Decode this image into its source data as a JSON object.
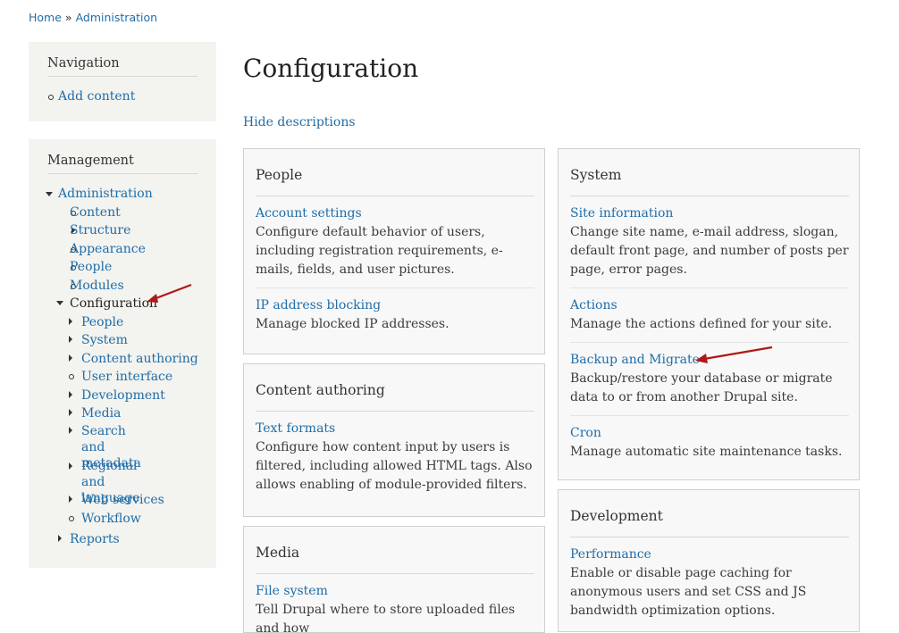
{
  "breadcrumb": {
    "home": "Home",
    "separator": "»",
    "admin": "Administration"
  },
  "navigation_block": {
    "title": "Navigation",
    "items": [
      "Add content"
    ]
  },
  "management_block": {
    "title": "Management",
    "administration": "Administration",
    "items": [
      "Content",
      "Structure",
      "Appearance",
      "People",
      "Modules",
      "Configuration"
    ],
    "config_children": [
      "People",
      "System",
      "Content authoring",
      "User interface",
      "Development",
      "Media",
      "Search and metadata",
      "Regional and language",
      "Web services",
      "Workflow"
    ],
    "reports": "Reports"
  },
  "main": {
    "title": "Configuration",
    "hide_descriptions": "Hide descriptions",
    "panels": {
      "people": {
        "title": "People",
        "items": [
          {
            "title": "Account settings",
            "desc": "Configure default behavior of users, including registration requirements, e-mails, fields, and user pictures."
          },
          {
            "title": "IP address blocking",
            "desc": "Manage blocked IP addresses."
          }
        ]
      },
      "content_authoring": {
        "title": "Content authoring",
        "items": [
          {
            "title": "Text formats",
            "desc": "Configure how content input by users is filtered, including allowed HTML tags. Also allows enabling of module-provided filters."
          }
        ]
      },
      "media": {
        "title": "Media",
        "items": [
          {
            "title": "File system",
            "desc": "Tell Drupal where to store uploaded files and how"
          }
        ]
      },
      "system": {
        "title": "System",
        "items": [
          {
            "title": "Site information",
            "desc": "Change site name, e-mail address, slogan, default front page, and number of posts per page, error pages."
          },
          {
            "title": "Actions",
            "desc": "Manage the actions defined for your site."
          },
          {
            "title": "Backup and Migrate",
            "desc": "Backup/restore your database or migrate data to or from another Drupal site."
          },
          {
            "title": "Cron",
            "desc": "Manage automatic site maintenance tasks."
          }
        ]
      },
      "development": {
        "title": "Development",
        "items": [
          {
            "title": "Performance",
            "desc": "Enable or disable page caching for anonymous users and set CSS and JS bandwidth optimization options."
          }
        ]
      }
    }
  },
  "colors": {
    "link": "#1f6da8",
    "sidebar_bg": "#f3f3ef",
    "panel_bg": "#f8f8f8",
    "annotation_arrow": "#b01818"
  }
}
